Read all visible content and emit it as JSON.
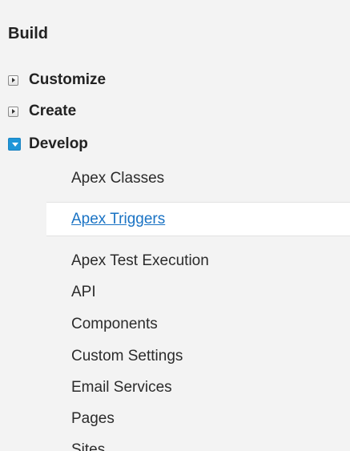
{
  "section": {
    "title": "Build"
  },
  "groups": [
    {
      "label": "Customize",
      "state": "collapsed"
    },
    {
      "label": "Create",
      "state": "collapsed"
    },
    {
      "label": "Develop",
      "state": "expanded"
    }
  ],
  "develop_items": [
    "Apex Classes",
    "Apex Triggers",
    "Apex Test Execution",
    "API",
    "Components",
    "Custom Settings",
    "Email Services",
    "Pages",
    "Sites"
  ],
  "selected_item": "Apex Triggers",
  "colors": {
    "background": "#f3f3f3",
    "selected_background": "#ffffff",
    "link": "#1a73c4",
    "expanded_toggle": "#1f96d8",
    "text": "#222222"
  },
  "icons": {
    "collapsed": "triangle-right-icon",
    "expanded": "triangle-down-icon"
  }
}
